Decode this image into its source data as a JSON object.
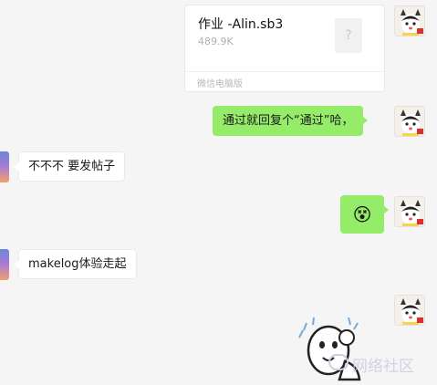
{
  "messages": [
    {
      "side": "me",
      "type": "file",
      "file_name": "作业 -Alin.sb3",
      "file_size": "489.9K",
      "file_icon": "?",
      "source": "微信电脑版"
    },
    {
      "side": "me",
      "type": "text",
      "text": "通过就回复个“通过”哈，"
    },
    {
      "side": "other",
      "type": "text",
      "text": "不不不 要发帖子"
    },
    {
      "side": "me",
      "type": "emoji",
      "emoji": "😵",
      "emoji_name": "dizzy-face"
    },
    {
      "side": "other",
      "type": "text",
      "text": "makelog体验走起"
    },
    {
      "side": "me",
      "type": "sticker",
      "sticker_name": "hand-drawn-cartoon-sticker"
    }
  ],
  "watermark": {
    "text": "网络社区",
    "icon": "speech-bubble-logo"
  },
  "colors": {
    "background": "#f5f5f5",
    "bubble_me": "#95ec69",
    "bubble_other": "#ffffff"
  }
}
